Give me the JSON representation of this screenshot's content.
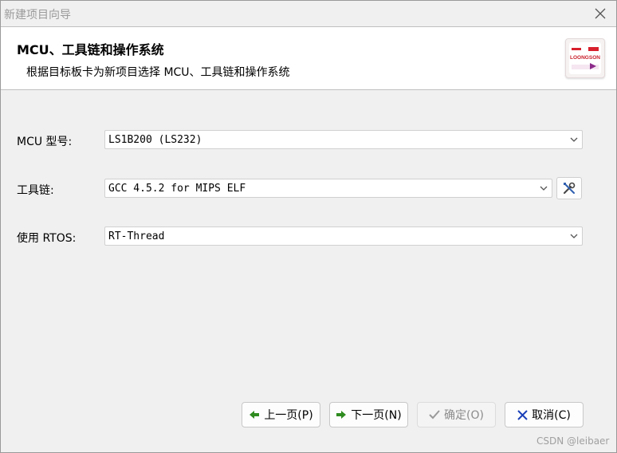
{
  "window": {
    "title": "新建项目向导"
  },
  "header": {
    "title": "MCU、工具链和操作系统",
    "subtitle": "根据目标板卡为新项目选择 MCU、工具链和操作系统",
    "logo_text": "LOONGSON"
  },
  "form": {
    "mcu": {
      "label": "MCU 型号:",
      "value": "LS1B200 (LS232)"
    },
    "toolchain": {
      "label": "工具链:",
      "value": "GCC 4.5.2 for MIPS ELF"
    },
    "rtos": {
      "label": "使用 RTOS:",
      "value": "RT-Thread"
    }
  },
  "buttons": {
    "prev": "上一页(P)",
    "next": "下一页(N)",
    "ok": "确定(O)",
    "cancel": "取消(C)"
  },
  "watermark": "CSDN @leibaer",
  "colors": {
    "arrow_green": "#2e8b1f",
    "cancel_blue": "#1a3fb8",
    "logo_red": "#d8202c",
    "logo_purple": "#8c2a8a"
  }
}
